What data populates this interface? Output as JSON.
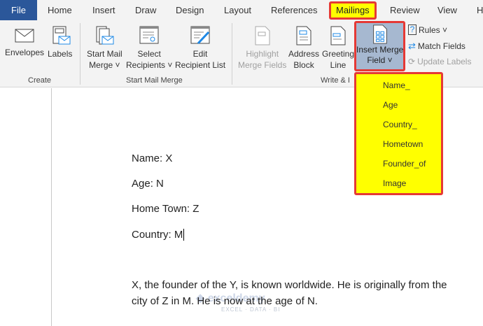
{
  "tabs": [
    "File",
    "Home",
    "Insert",
    "Draw",
    "Design",
    "Layout",
    "References",
    "Mailings",
    "Review",
    "View",
    "H"
  ],
  "ribbon": {
    "envelopes": "Envelopes",
    "labels": "Labels",
    "create_group": "Create",
    "start_mail_merge": [
      "Start Mail",
      "Merge ˅"
    ],
    "select_recipients": [
      "Select",
      "Recipients ˅"
    ],
    "edit_recipient_list": [
      "Edit",
      "Recipient List"
    ],
    "start_group": "Start Mail Merge",
    "highlight": [
      "Highlight",
      "Merge Fields"
    ],
    "address_block": [
      "Address",
      "Block"
    ],
    "greeting_line": [
      "Greeting",
      "Line"
    ],
    "insert_merge_field": [
      "Insert Merge",
      "Field ˅"
    ],
    "write_group": "Write & I",
    "rules": "Rules ˅",
    "match_fields": "Match Fields",
    "update_labels": "Update Labels"
  },
  "dropdown": [
    "Name_",
    "Age",
    "Country_",
    "Hometown",
    "Founder_of",
    "Image"
  ],
  "document": {
    "lines": [
      "Name: X",
      "Age: N",
      "Home Town: Z",
      "Country: M"
    ],
    "paragraph": [
      "X, the founder of the Y, is known worldwide. He is originally from the",
      "city of Z in M. He is now at the age of N."
    ]
  },
  "watermark": {
    "name": "exceldemy",
    "tagline": "EXCEL · DATA · BI"
  },
  "colors": {
    "file_tab": "#2b579a",
    "highlight": "#ffff00",
    "outline": "#e53935",
    "selected": "#a6b8d0"
  }
}
